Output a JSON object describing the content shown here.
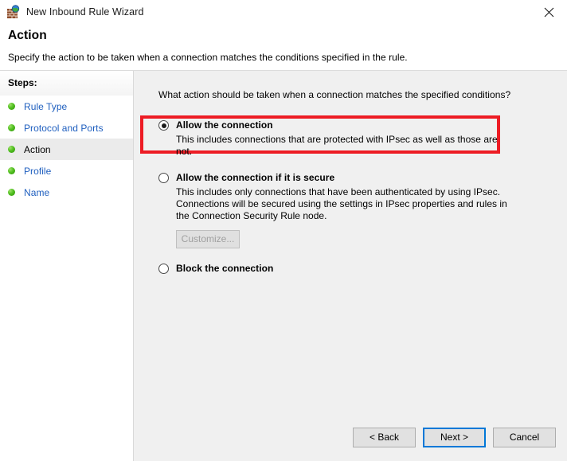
{
  "window": {
    "title": "New Inbound Rule Wizard",
    "icon": "firewall-globe-icon",
    "close_label": "✕"
  },
  "header": {
    "title": "Action",
    "subtitle": "Specify the action to be taken when a connection matches the conditions specified in the rule."
  },
  "sidebar": {
    "header": "Steps:",
    "items": [
      {
        "label": "Rule Type",
        "current": false
      },
      {
        "label": "Protocol and Ports",
        "current": false
      },
      {
        "label": "Action",
        "current": true
      },
      {
        "label": "Profile",
        "current": false
      },
      {
        "label": "Name",
        "current": false
      }
    ]
  },
  "main": {
    "question": "What action should be taken when a connection matches the specified conditions?",
    "options": [
      {
        "title": "Allow the connection",
        "description": "This includes connections that are protected with IPsec as well as those are not.",
        "selected": true,
        "highlighted": true
      },
      {
        "title": "Allow the connection if it is secure",
        "description": "This includes only connections that have been authenticated by using IPsec.  Connections will be secured using the settings in IPsec properties and rules in the Connection Security Rule node.",
        "selected": false,
        "highlighted": false,
        "button": {
          "label": "Customize...",
          "disabled": true
        }
      },
      {
        "title": "Block the connection",
        "description": "",
        "selected": false,
        "highlighted": false
      }
    ]
  },
  "footer": {
    "back_label": "< Back",
    "next_label": "Next >",
    "cancel_label": "Cancel"
  },
  "colors": {
    "annotation_red": "#ed1c24",
    "link_blue": "#1f5fbf",
    "focus_blue": "#0078d7",
    "panel_gray": "#f0f0f0",
    "bullet_green": "#54c223"
  }
}
